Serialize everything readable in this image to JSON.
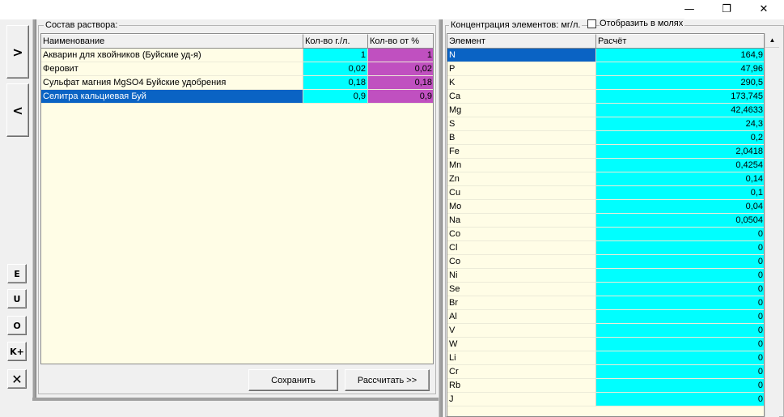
{
  "window": {
    "minimize_glyph": "—",
    "maximize_glyph": "❐",
    "close_glyph": "✕"
  },
  "toolbar": {
    "add_label": ">",
    "remove_label": "<",
    "btn_e": "E",
    "btn_u": "U",
    "btn_o": "O",
    "btn_k": "K+",
    "btn_x": "✕"
  },
  "solution": {
    "title": "Состав раствора:",
    "columns": [
      "Наименование",
      "Кол-во г./л.",
      "Кол-во от %"
    ],
    "rows": [
      {
        "name": "Акварин для хвойников (Буйские уд-я)",
        "grams": "1",
        "percent": "1"
      },
      {
        "name": "Феровит",
        "grams": "0,02",
        "percent": "0,02"
      },
      {
        "name": "Сульфат магния MgSO4 Буйские удобрения",
        "grams": "0,18",
        "percent": "0,18"
      },
      {
        "name": "Селитра кальциевая Буй",
        "grams": "0,9",
        "percent": "0,9"
      }
    ],
    "selected_row": 3,
    "save_label": "Сохранить",
    "calc_label": "Рассчитать >>"
  },
  "concentration": {
    "title": "Концентрация элементов: мг/л.",
    "moles_label": "Отобразить в молях",
    "moles_checked": false,
    "columns": [
      "Элемент",
      "Расчёт"
    ],
    "rows": [
      {
        "element": "N",
        "value": "164,9"
      },
      {
        "element": "P",
        "value": "47,96"
      },
      {
        "element": "K",
        "value": "290,5"
      },
      {
        "element": "Ca",
        "value": "173,745"
      },
      {
        "element": "Mg",
        "value": "42,4633"
      },
      {
        "element": "S",
        "value": "24,3"
      },
      {
        "element": "B",
        "value": "0,2"
      },
      {
        "element": "Fe",
        "value": "2,0418"
      },
      {
        "element": "Mn",
        "value": "0,4254"
      },
      {
        "element": "Zn",
        "value": "0,14"
      },
      {
        "element": "Cu",
        "value": "0,1"
      },
      {
        "element": "Mo",
        "value": "0,04"
      },
      {
        "element": "Na",
        "value": "0,0504"
      },
      {
        "element": "Co",
        "value": "0"
      },
      {
        "element": "Cl",
        "value": "0"
      },
      {
        "element": "Co",
        "value": "0"
      },
      {
        "element": "Ni",
        "value": "0"
      },
      {
        "element": "Se",
        "value": "0"
      },
      {
        "element": "Br",
        "value": "0"
      },
      {
        "element": "Al",
        "value": "0"
      },
      {
        "element": "V",
        "value": "0"
      },
      {
        "element": "W",
        "value": "0"
      },
      {
        "element": "Li",
        "value": "0"
      },
      {
        "element": "Cr",
        "value": "0"
      },
      {
        "element": "Rb",
        "value": "0"
      },
      {
        "element": "J",
        "value": "0"
      }
    ],
    "selected_row": 0,
    "scroll_up_glyph": "▲"
  },
  "colors": {
    "grid_bg": "#fffde6",
    "cyan": "#00ffff",
    "magenta": "#c050c0",
    "selection": "#0a63c4"
  }
}
